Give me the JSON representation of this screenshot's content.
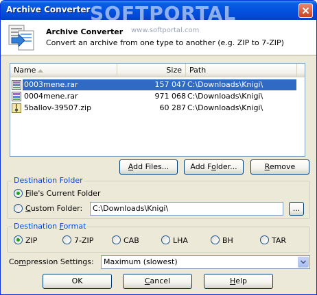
{
  "window": {
    "title": "Archive Converter",
    "watermark": "SOFTPORTAL",
    "close_label": "✕"
  },
  "header": {
    "title": "Archive Converter",
    "description": "Convert an archive from one type to another (e.g. ZIP to 7-ZIP)",
    "watermark_url": "www.softportal.com"
  },
  "file_list": {
    "columns": {
      "name": "Name",
      "size": "Size",
      "path": "Path"
    },
    "rows": [
      {
        "name": "0003mene.rar",
        "size": "157 047",
        "path": "C:\\Downloads\\Knigi\\",
        "icon": "rar-archive-icon",
        "selected": true
      },
      {
        "name": "0004mene.rar",
        "size": "971 068",
        "path": "C:\\Downloads\\Knigi\\",
        "icon": "rar-archive-icon",
        "selected": false
      },
      {
        "name": "5ballov-39507.zip",
        "size": "60 287",
        "path": "C:\\Downloads\\Knigi\\",
        "icon": "zip-archive-icon",
        "selected": false
      }
    ]
  },
  "list_buttons": {
    "add_files": {
      "pre": "",
      "ul": "A",
      "post": "dd Files..."
    },
    "add_folder": {
      "pre": "Add F",
      "ul": "o",
      "post": "lder..."
    },
    "remove": {
      "pre": "",
      "ul": "R",
      "post": "emove"
    }
  },
  "destination_folder": {
    "label": "Destination Folder",
    "option_current": {
      "pre": "",
      "ul": "F",
      "post": "ile's Current Folder",
      "checked": true
    },
    "option_custom": {
      "pre": "",
      "ul": "C",
      "post": "ustom Folder:",
      "checked": false
    },
    "custom_path": "C:\\Downloads\\Knigi\\",
    "browse_label": "..."
  },
  "destination_format": {
    "label_pre": "Destination ",
    "label_ul": "F",
    "label_post": "ormat",
    "options": [
      {
        "label": "ZIP",
        "checked": true
      },
      {
        "label": "7-ZIP",
        "checked": false
      },
      {
        "label": "CAB",
        "checked": false
      },
      {
        "label": "LHA",
        "checked": false
      },
      {
        "label": "BH",
        "checked": false
      },
      {
        "label": "TAR",
        "checked": false
      }
    ]
  },
  "compression": {
    "label_pre": "Co",
    "label_ul": "m",
    "label_post": "pression Settings:",
    "value": "Maximum (slowest)"
  },
  "dialog_buttons": {
    "ok": "OK",
    "cancel": {
      "pre": "",
      "ul": "C",
      "post": "ancel"
    },
    "help": {
      "pre": "",
      "ul": "H",
      "post": "elp"
    }
  }
}
